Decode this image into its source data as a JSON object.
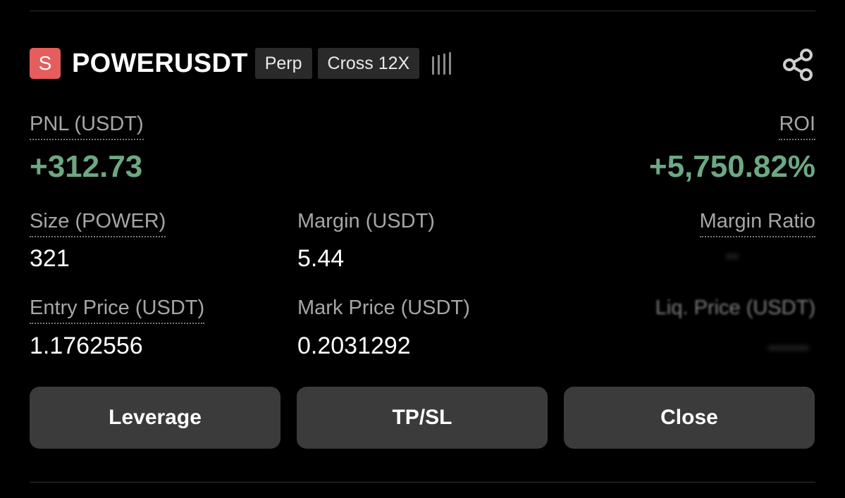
{
  "header": {
    "side_badge": "S",
    "symbol": "POWERUSDT",
    "contract_type": "Perp",
    "margin_mode": "Cross 12X",
    "risk_indicator": "!!!!",
    "share_icon": "share-icon"
  },
  "pnl": {
    "label": "PNL (USDT)",
    "value": "+312.73"
  },
  "roi": {
    "label": "ROI",
    "value": "+5,750.82%"
  },
  "size": {
    "label": "Size (POWER)",
    "value": "321"
  },
  "margin": {
    "label": "Margin (USDT)",
    "value": "5.44"
  },
  "margin_ratio": {
    "label": "Margin Ratio"
  },
  "entry_price": {
    "label": "Entry Price (USDT)",
    "value": "1.1762556"
  },
  "mark_price": {
    "label": "Mark Price (USDT)",
    "value": "0.2031292"
  },
  "liq_price": {
    "label": "Liq. Price (USDT)"
  },
  "actions": {
    "leverage": "Leverage",
    "tpsl": "TP/SL",
    "close": "Close"
  },
  "colors": {
    "profit": "#6da883",
    "sell_badge": "#e55d5d",
    "button_bg": "#3b3b3b",
    "chip_bg": "#2a2a2a"
  }
}
